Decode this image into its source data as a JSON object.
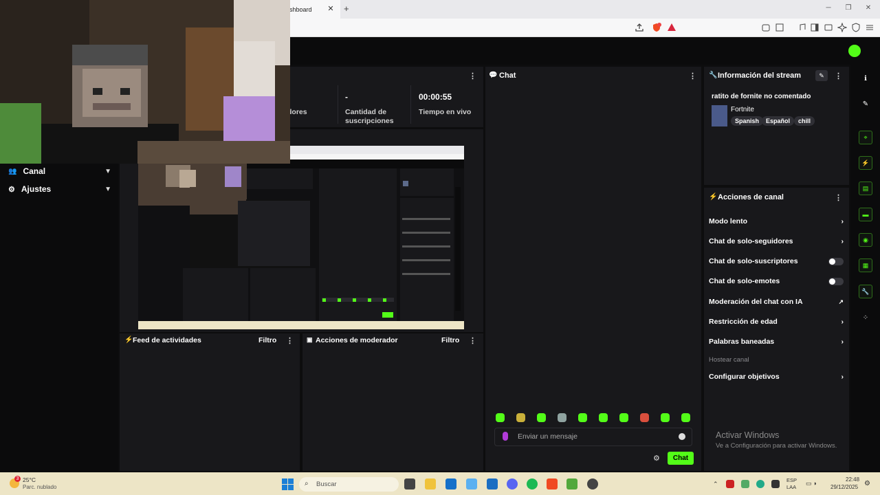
{
  "browser": {
    "tab_title": "shboard",
    "tab_close": "✕",
    "tab_new": "+",
    "minimize": "─",
    "maximize": "❐",
    "close": "✕"
  },
  "sidebar": {
    "items": [
      {
        "label": "Canal",
        "icon": "users-icon"
      },
      {
        "label": "Ajustes",
        "icon": "gear-icon"
      }
    ]
  },
  "stats": [
    {
      "value": "",
      "label": "dores"
    },
    {
      "value": "-",
      "label": "Cantidad de suscripciones"
    },
    {
      "value": "00:00:55",
      "label": "Tiempo en vivo"
    }
  ],
  "activity_feed": {
    "title": "Feed de actividades",
    "filter": "Filtro"
  },
  "mod_actions": {
    "title": "Acciones de moderador",
    "filter": "Filtro"
  },
  "chat": {
    "title": "Chat",
    "input_placeholder": "Enviar un mensaje",
    "send_label": "Chat"
  },
  "stream_info": {
    "title": "Información del stream",
    "stream_title": "ratito de fornite no comentado",
    "category": "Fortnite",
    "tags": [
      "Spanish",
      "Español",
      "chill"
    ]
  },
  "channel_actions": {
    "title": "Acciones de canal",
    "items": [
      {
        "label": "Modo lento",
        "control": "chevron"
      },
      {
        "label": "Chat de solo-seguidores",
        "control": "chevron"
      },
      {
        "label": "Chat de solo-suscriptores",
        "control": "toggle"
      },
      {
        "label": "Chat de solo-emotes",
        "control": "toggle"
      },
      {
        "label": "Moderación del chat con IA",
        "control": "external"
      },
      {
        "label": "Restricción de edad",
        "control": "chevron"
      },
      {
        "label": "Palabras baneadas",
        "control": "chevron"
      },
      {
        "label": "Hostear canal",
        "control": "none"
      },
      {
        "label": "Configurar objetivos",
        "control": "chevron"
      }
    ]
  },
  "windows": {
    "activate_title": "Activar Windows",
    "activate_sub": "Ve a Configuración para activar Windows."
  },
  "taskbar": {
    "weather_temp": "25°C",
    "weather_desc": "Parc. nublado",
    "weather_badge": "3",
    "search_placeholder": "Buscar",
    "lang": "ESP",
    "lang_sub": "LAA",
    "time": "22:48",
    "date": "29/12/2025"
  },
  "colors": {
    "accent": "#53fc18",
    "panel": "#18181b",
    "background": "#0d0d0e"
  }
}
